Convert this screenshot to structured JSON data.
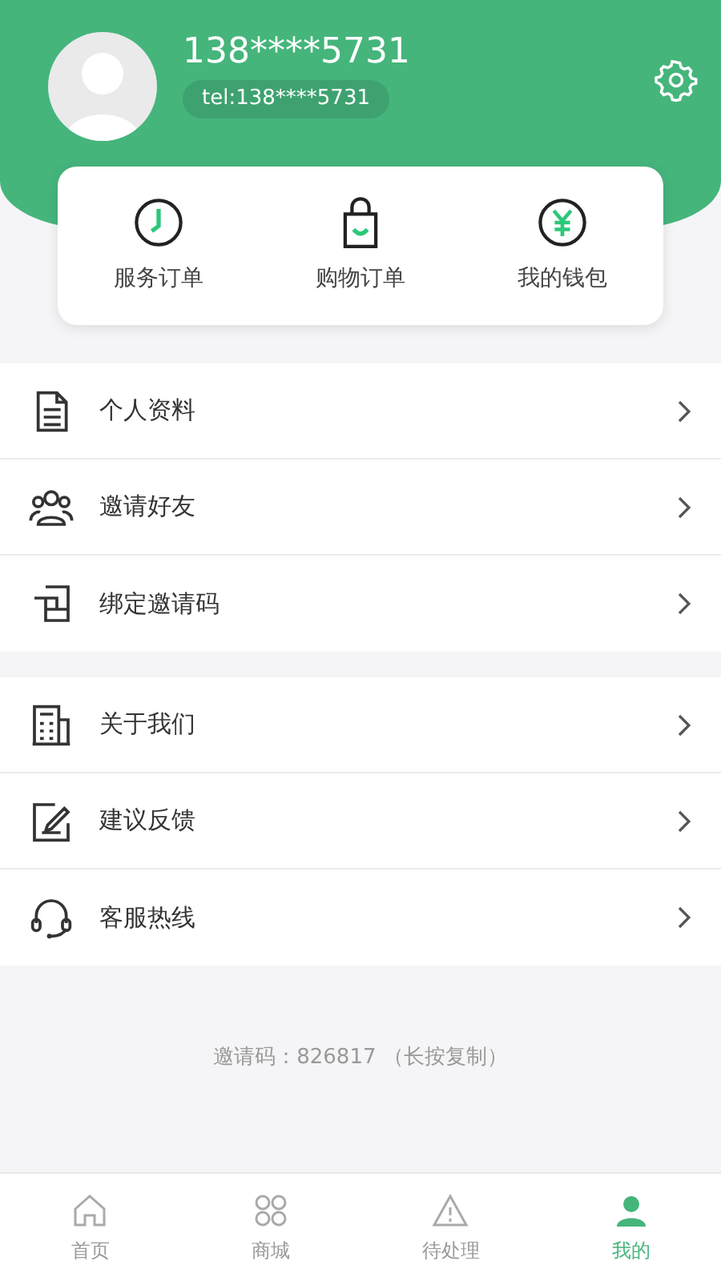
{
  "profile": {
    "name": "138****5731",
    "tel": "tel:138****5731"
  },
  "shortcuts": [
    {
      "kind": "clock",
      "label": "服务订单"
    },
    {
      "kind": "bag",
      "label": "购物订单"
    },
    {
      "kind": "wallet",
      "label": "我的钱包"
    }
  ],
  "menu_groups": [
    [
      {
        "kind": "doc",
        "label": "个人资料"
      },
      {
        "kind": "people",
        "label": "邀请好友"
      },
      {
        "kind": "bind",
        "label": "绑定邀请码"
      }
    ],
    [
      {
        "kind": "building",
        "label": "关于我们"
      },
      {
        "kind": "edit",
        "label": "建议反馈"
      },
      {
        "kind": "headset",
        "label": "客服热线"
      }
    ]
  ],
  "invite_note": "邀请码：826817  （长按复制）",
  "tabs": [
    {
      "kind": "home",
      "label": "首页",
      "selected": false
    },
    {
      "kind": "shop",
      "label": "商城",
      "selected": false
    },
    {
      "kind": "alert",
      "label": "待处理",
      "selected": false
    },
    {
      "kind": "me",
      "label": "我的",
      "selected": true
    }
  ]
}
